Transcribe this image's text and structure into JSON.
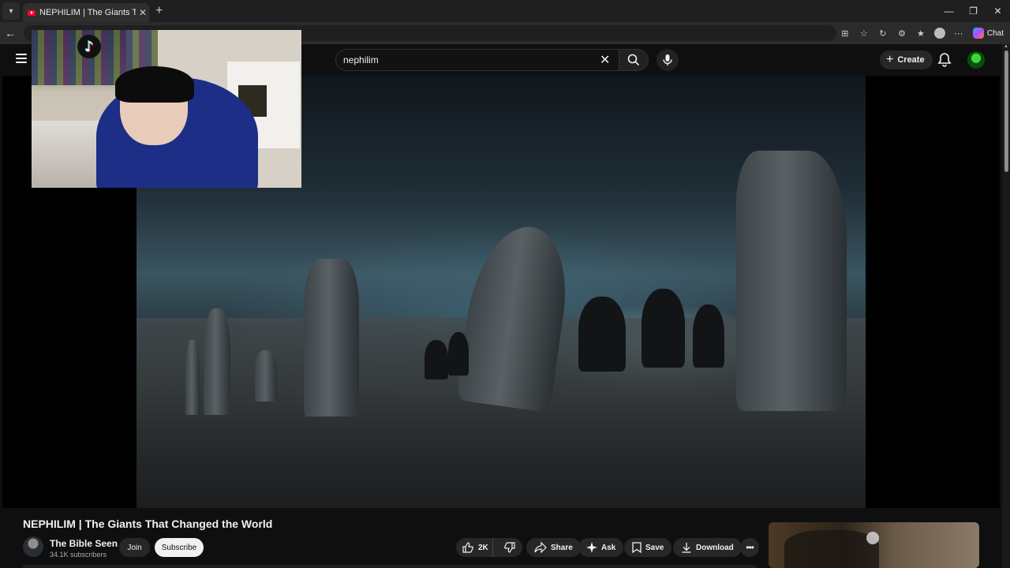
{
  "browser": {
    "tab_title": "NEPHILIM | The Giants That Changed the World",
    "tab_close": "✕",
    "new_tab": "+",
    "window_controls": {
      "minimize": "—",
      "restore": "❐",
      "close": "✕"
    },
    "chat_label": "Chat",
    "colors": {
      "tab_bar": "#1f1f1f",
      "address_bar": "#2b2b2b"
    }
  },
  "youtube_header": {
    "search_value": "nephilim",
    "create_label": "Create",
    "icons": [
      "menu-icon",
      "close-icon",
      "search-icon",
      "mic-icon",
      "plus-icon",
      "bell-icon"
    ]
  },
  "video": {
    "title": "NEPHILIM | The Giants That Changed the World"
  },
  "channel": {
    "name": "The Bible Seen",
    "subscribers": "34.1K subscribers",
    "join_label": "Join",
    "subscribe_label": "Subscribe"
  },
  "actions": {
    "like_count": "2K",
    "share_label": "Share",
    "ask_label": "Ask",
    "save_label": "Save",
    "download_label": "Download",
    "more_label": "•••"
  },
  "colors": {
    "page_bg": "#0f0f0f",
    "pill_bg": "#272727",
    "subscribe_bg": "#f1f1f1",
    "text_primary": "#f1f1f1",
    "text_secondary": "#aaaaaa"
  }
}
